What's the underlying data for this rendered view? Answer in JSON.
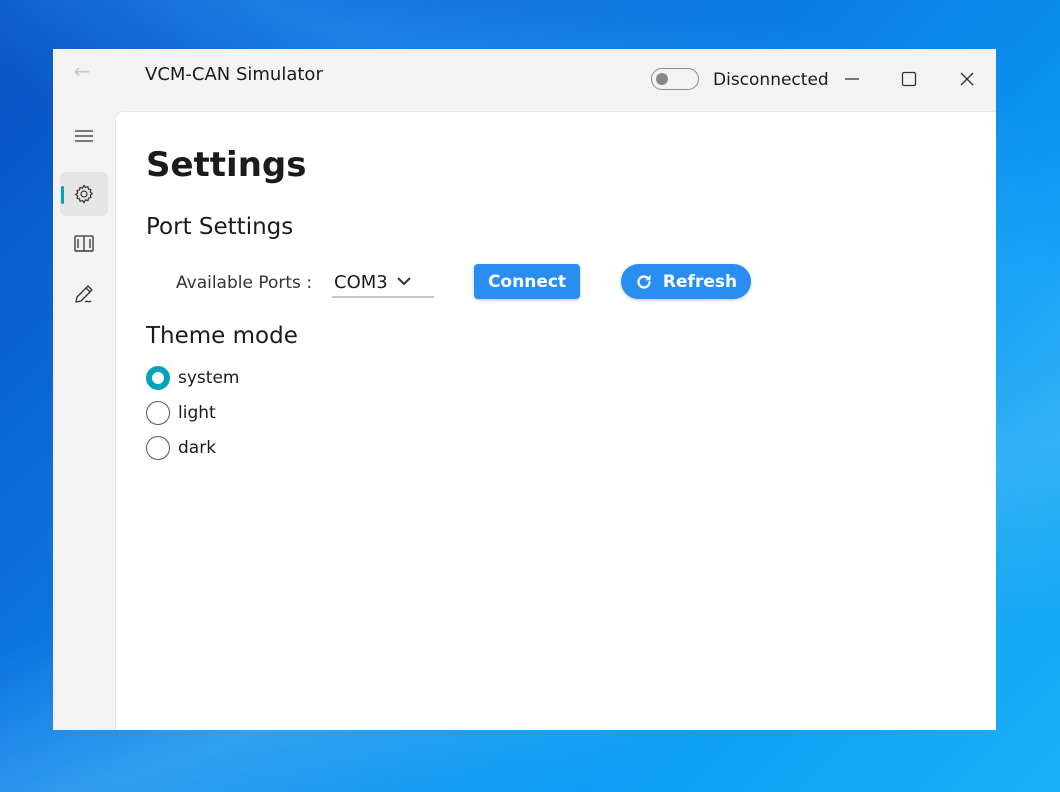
{
  "window": {
    "title": "VCM-CAN Simulator",
    "back_icon": "←",
    "connection_status": "Disconnected",
    "connected": false
  },
  "nav": {
    "items": [
      {
        "name": "menu",
        "icon": "hamburger-icon"
      },
      {
        "name": "settings",
        "icon": "gear-icon",
        "selected": true
      },
      {
        "name": "docs",
        "icon": "book-icon"
      },
      {
        "name": "edit",
        "icon": "pen-icon"
      }
    ]
  },
  "page": {
    "title": "Settings",
    "port_section": "Port Settings",
    "ports_label": "Available Ports :",
    "selected_port": "COM3",
    "connect_label": "Connect",
    "refresh_label": "Refresh",
    "theme_section": "Theme mode",
    "theme_options": [
      {
        "label": "system",
        "checked": true
      },
      {
        "label": "light",
        "checked": false
      },
      {
        "label": "dark",
        "checked": false
      }
    ]
  },
  "colors": {
    "accent": "#00a3b8",
    "button": "#2a8df0"
  }
}
